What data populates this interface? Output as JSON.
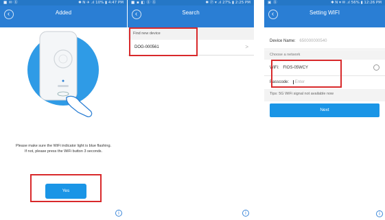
{
  "screen1": {
    "status_left": "■ ✉ ⓖ",
    "status_right": "✱ N ✈ .ıl 10% ▮ 4:47 PM",
    "title": "Added",
    "instruction_line1": "Please make sure the WiFi indicator light is blue flashing.",
    "instruction_line2": "If not, please press the WiFi button 3 seconds.",
    "yes_label": "Yes",
    "info": "i"
  },
  "screen2": {
    "status_left": "■ ▪ ◧ ⓖ ⓖ",
    "status_right": "✱ ⓟ ▾ .ıl 27% ▮ 2:25 PM",
    "title": "Search",
    "find_label": "Find new device",
    "device_id": "DOG-000561",
    "chevron": ">",
    "info": "i"
  },
  "screen3": {
    "status_left": "▣ ⓖ",
    "status_right": "✱ N ▾ ✉ .ıl 56% ▮ 12:26 PM",
    "title": "Setting WIFI",
    "device_name_label": "Device Name:",
    "device_name_value": "650000000540",
    "choose_network": "Choose a network",
    "wifi_label": "WiFi:",
    "wifi_value": "FIOS-05WCY",
    "passcode_label": "Passcode:",
    "passcode_placeholder": "Enter",
    "tips": "Tips: 5G WiFi signal not available now",
    "next_label": "Next",
    "info": "i"
  }
}
